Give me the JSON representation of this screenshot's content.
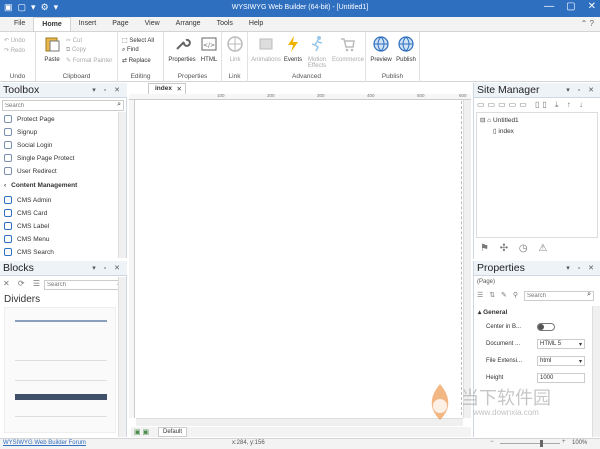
{
  "title_bar": {
    "title": "WYSIWYG Web Builder (64-bit) - [Untitled1]"
  },
  "menu": {
    "tabs": [
      "File",
      "Home",
      "Insert",
      "Page",
      "View",
      "Arrange",
      "Tools",
      "Help"
    ],
    "active": "Home"
  },
  "ribbon": {
    "undo": {
      "undo": "Undo",
      "redo": "Redo",
      "label": "Undo"
    },
    "clipboard": {
      "paste": "Paste",
      "cut": "Cut",
      "copy": "Copy",
      "format_painter": "Format Painter",
      "label": "Clipboard"
    },
    "editing": {
      "select_all": "Select All",
      "find": "Find",
      "replace": "Replace",
      "label": "Editing"
    },
    "properties": {
      "properties": "Properties",
      "html": "HTML",
      "label": "Properties"
    },
    "link": {
      "link": "Link",
      "label": "Link"
    },
    "advanced": {
      "animations": "Animations",
      "events": "Events",
      "motion_effects": "Motion Effects",
      "ecommerce": "Ecommerce",
      "label": "Advanced"
    },
    "publish": {
      "preview": "Preview",
      "publish": "Publish",
      "label": "Publish"
    }
  },
  "toolbox": {
    "title": "Toolbox",
    "search_placeholder": "Search",
    "items": [
      "Protect Page",
      "Signup",
      "Social Login",
      "Single Page Protect",
      "User Redirect"
    ],
    "section": "Content Management",
    "cms_items": [
      "CMS Admin",
      "CMS Card",
      "CMS Label",
      "CMS Menu",
      "CMS Search"
    ]
  },
  "blocks": {
    "title": "Blocks",
    "search_placeholder": "Search",
    "category": "Dividers"
  },
  "editor": {
    "tab": "index",
    "ruler": [
      "100",
      "200",
      "300",
      "400",
      "500",
      "600"
    ],
    "bottom_tab": "Default"
  },
  "site_manager": {
    "title": "Site Manager",
    "root": "Untitled1",
    "page": "index"
  },
  "properties": {
    "title": "Properties",
    "object": "(Page)",
    "search_placeholder": "Search",
    "section": "General",
    "rows": [
      {
        "label": "Center in B...",
        "value": ""
      },
      {
        "label": "Document ...",
        "value": "HTML 5"
      },
      {
        "label": "File Extensi...",
        "value": "html"
      },
      {
        "label": "Height",
        "value": "1000"
      }
    ]
  },
  "status": {
    "link": "WYSIWYG Web Builder Forum",
    "coords": "x:284, y:156",
    "zoom": "100%"
  },
  "watermark": {
    "text": "当下软件园",
    "url": "www.downxia.com"
  },
  "colors": {
    "titlebar": "#2f6fc0",
    "accent": "#2f6fc0"
  }
}
